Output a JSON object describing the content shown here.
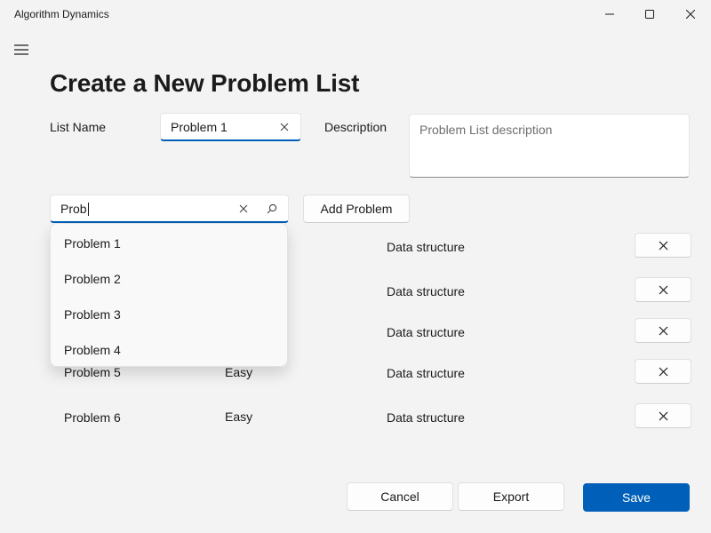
{
  "window": {
    "title": "Algorithm Dynamics"
  },
  "page": {
    "title": "Create a New Problem List"
  },
  "form": {
    "list_name_label": "List Name",
    "list_name_value": "Problem 1",
    "description_label": "Description",
    "description_placeholder": "Problem List description"
  },
  "search": {
    "value": "Prob",
    "add_button_label": "Add Problem",
    "suggestions": [
      "Problem 1",
      "Problem 2",
      "Problem 3",
      "Problem 4"
    ]
  },
  "problems": [
    {
      "name": "",
      "difficulty": "",
      "tag": "Data structure"
    },
    {
      "name": "",
      "difficulty": "",
      "tag": "Data structure"
    },
    {
      "name": "",
      "difficulty": "",
      "tag": "Data structure"
    },
    {
      "name": "Problem 5",
      "difficulty": "Easy",
      "tag": "Data structure"
    },
    {
      "name": "Problem 6",
      "difficulty": "Easy",
      "tag": "Data structure"
    }
  ],
  "footer": {
    "cancel_label": "Cancel",
    "export_label": "Export",
    "save_label": "Save"
  },
  "icons": {
    "minimize": "minimize-icon",
    "maximize": "maximize-icon",
    "close": "close-icon",
    "menu": "hamburger-menu-icon",
    "clear": "clear-icon",
    "search": "search-icon",
    "remove": "remove-icon"
  },
  "colors": {
    "accent": "#005fb8",
    "background": "#f3f3f3"
  }
}
